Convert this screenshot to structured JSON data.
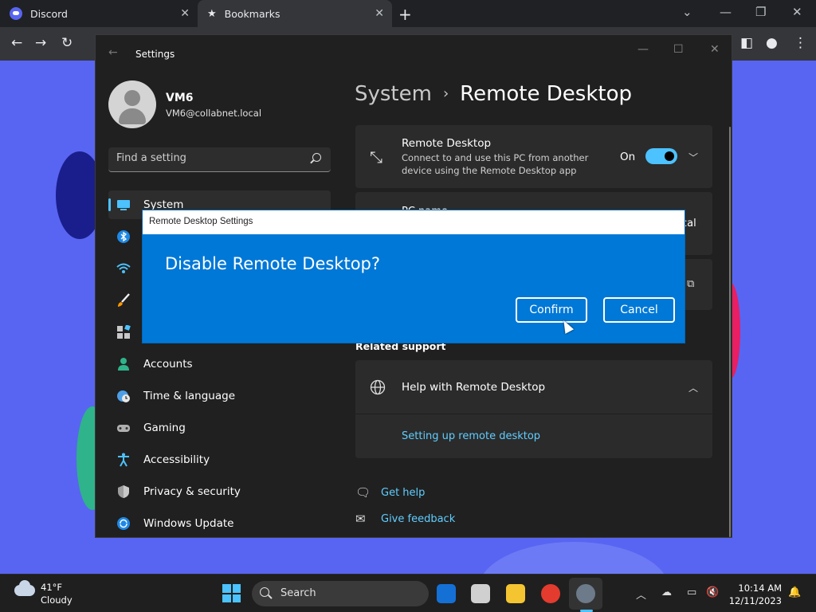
{
  "browser": {
    "tabs": [
      {
        "label": "Discord"
      },
      {
        "label": "Bookmarks"
      }
    ],
    "close_glyph": "✕",
    "new_tab_glyph": "+"
  },
  "settings": {
    "window_title": "Settings",
    "user": {
      "name": "VM6",
      "email": "VM6@collabnet.local"
    },
    "search_placeholder": "Find a setting",
    "nav": [
      {
        "label": "System",
        "icon": "monitor-icon"
      },
      {
        "label": "",
        "icon": "bluetooth-icon"
      },
      {
        "label": "",
        "icon": "wifi-icon"
      },
      {
        "label": "",
        "icon": "brush-icon"
      },
      {
        "label": "",
        "icon": "apps-icon"
      },
      {
        "label": "Accounts",
        "icon": "person-icon"
      },
      {
        "label": "Time & language",
        "icon": "globe-clock-icon"
      },
      {
        "label": "Gaming",
        "icon": "gamepad-icon"
      },
      {
        "label": "Accessibility",
        "icon": "accessibility-icon"
      },
      {
        "label": "Privacy & security",
        "icon": "shield-icon"
      },
      {
        "label": "Windows Update",
        "icon": "update-icon"
      }
    ],
    "breadcrumb_parent": "System",
    "breadcrumb_current": "Remote Desktop",
    "remote_desktop": {
      "title": "Remote Desktop",
      "description": "Connect to and use this PC from another device using the Remote Desktop app",
      "state_label": "On",
      "enabled": true
    },
    "pc_name": {
      "label": "PC name",
      "value_partial": "cal"
    },
    "related_support": "Related support",
    "help": {
      "title": "Help with Remote Desktop",
      "link": "Setting up remote desktop"
    },
    "get_help": "Get help",
    "give_feedback": "Give feedback"
  },
  "dialog": {
    "title": "Remote Desktop Settings",
    "question": "Disable Remote Desktop?",
    "confirm": "Confirm",
    "cancel": "Cancel"
  },
  "taskbar": {
    "weather": {
      "temp": "41°F",
      "condition": "Cloudy"
    },
    "search_label": "Search",
    "time": "10:14 AM",
    "date": "12/11/2023"
  },
  "colors": {
    "accent": "#4cc2ff",
    "dialog": "#0078d7",
    "desktop": "#5865f2",
    "link": "#60cdff"
  }
}
